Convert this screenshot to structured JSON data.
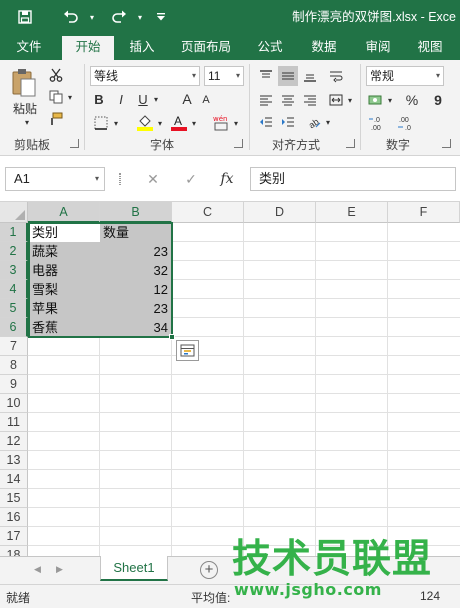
{
  "window": {
    "title": "制作漂亮的双饼图.xlsx - Exce"
  },
  "quick_access": {
    "save_icon": "save-icon",
    "undo_icon": "undo-icon",
    "redo_icon": "redo-icon",
    "customize_icon": "customize-qat-icon",
    "dropdown_glyph": "▾",
    "save_glyph": "🖫",
    "undo_glyph": "↶",
    "redo_glyph": "↷",
    "customize_glyph": "⩡"
  },
  "ribbon_tabs": [
    {
      "label": "文件"
    },
    {
      "label": "开始",
      "active": true
    },
    {
      "label": "插入"
    },
    {
      "label": "页面布局"
    },
    {
      "label": "公式"
    },
    {
      "label": "数据"
    },
    {
      "label": "审阅"
    },
    {
      "label": "视图"
    }
  ],
  "clipboard": {
    "paste_label": "粘贴",
    "group_label": "剪贴板"
  },
  "font": {
    "name": "等线",
    "size": "11",
    "bold": "B",
    "italic": "I",
    "underline": "U",
    "grow": "A",
    "shrink": "A",
    "fill_color": "#ffff00",
    "font_color": "#e81123",
    "group_label": "字体"
  },
  "alignment": {
    "group_label": "对齐方式"
  },
  "number": {
    "format": "常规",
    "percent": "%",
    "comma": "9",
    "inc_decimal": "←.0\n.00",
    "group_label": "数字"
  },
  "formula_bar": {
    "name_box": "A1",
    "cancel": "✕",
    "enter": "✓",
    "fx": "fx",
    "content": "类别"
  },
  "sheet": {
    "columns": [
      "A",
      "B",
      "C",
      "D",
      "E",
      "F"
    ],
    "selected_columns": [
      "A",
      "B"
    ],
    "rows": [
      "1",
      "2",
      "3",
      "4",
      "5",
      "6",
      "7",
      "8",
      "9",
      "10",
      "11",
      "12",
      "13",
      "14",
      "15",
      "16",
      "17",
      "18"
    ],
    "cells": [
      {
        "a": "类别",
        "b": "数量"
      },
      {
        "a": "蔬菜",
        "b": "23"
      },
      {
        "a": "电器",
        "b": "32"
      },
      {
        "a": "雪梨",
        "b": "12"
      },
      {
        "a": "苹果",
        "b": "23"
      },
      {
        "a": "香蕉",
        "b": "34"
      }
    ]
  },
  "sheet_tabs": {
    "active": "Sheet1",
    "add": "+"
  },
  "status_bar": {
    "ready": "就绪",
    "average_label": "平均值:",
    "count_partial": "124"
  },
  "watermark": {
    "brand": "技术员联盟",
    "url": "www.jsgho.com"
  },
  "colors": {
    "accent": "#217346",
    "selection": "#c6c6c6",
    "watermark": "#35b24a"
  }
}
